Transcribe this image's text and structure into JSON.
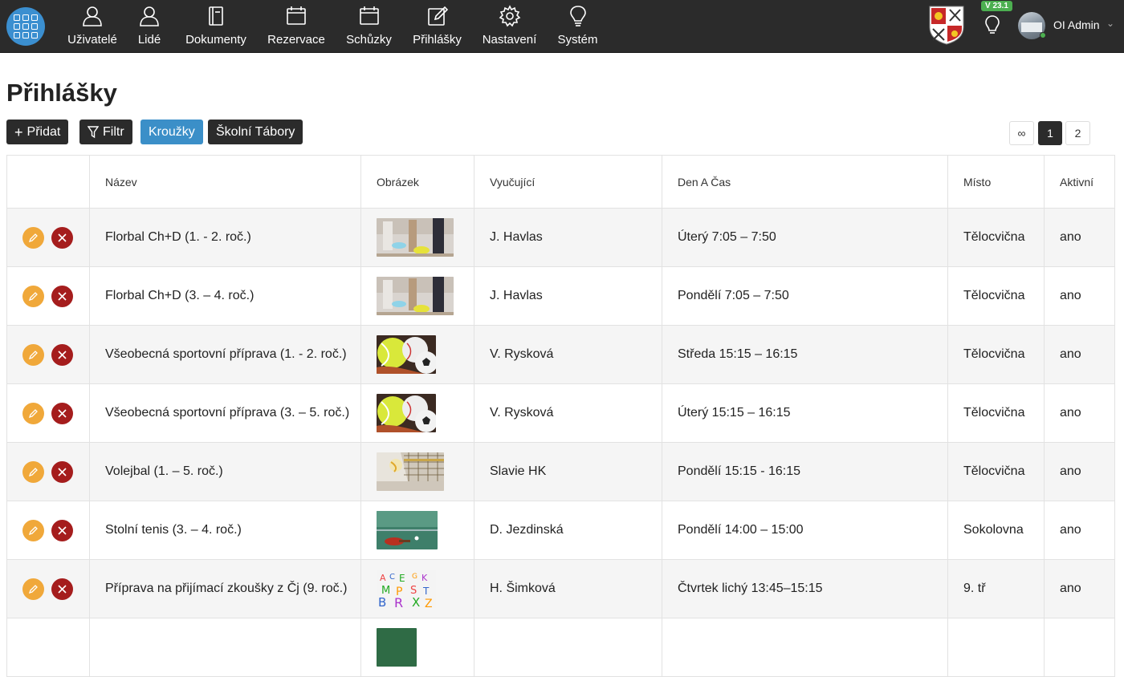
{
  "nav": {
    "items": [
      {
        "label": "Uživatelé",
        "icon": "user-icon"
      },
      {
        "label": "Lidé",
        "icon": "people-icon"
      },
      {
        "label": "Dokumenty",
        "icon": "document-icon"
      },
      {
        "label": "Rezervace",
        "icon": "calendar-icon"
      },
      {
        "label": "Schůzky",
        "icon": "calendar-icon"
      },
      {
        "label": "Přihlášky",
        "icon": "form-edit-icon"
      },
      {
        "label": "Nastavení",
        "icon": "gear-icon"
      },
      {
        "label": "Systém",
        "icon": "lightbulb-icon"
      }
    ],
    "version": "V 23.1",
    "user_name": "OI Admin"
  },
  "page": {
    "title": "Přihlášky",
    "buttons": {
      "add": "Přidat",
      "filter": "Filtr",
      "clubs": "Kroužky",
      "camps": "Školní Tábory"
    },
    "pagination": [
      "∞",
      "1",
      "2"
    ],
    "active_page": "1"
  },
  "table": {
    "headers": [
      "",
      "Název",
      "Obrázek",
      "Vyučující",
      "Den A Čas",
      "Místo",
      "Aktivní"
    ],
    "rows": [
      {
        "name": "Florbal Ch+D (1. - 2. roč.)",
        "image": "floorball",
        "teacher": "J. Havlas",
        "time": "Úterý 7:05 – 7:50",
        "place": "Tělocvična",
        "active": "ano"
      },
      {
        "name": "Florbal Ch+D (3. – 4. roč.)",
        "image": "floorball",
        "teacher": "J. Havlas",
        "time": "Pondělí 7:05 – 7:50",
        "place": "Tělocvična",
        "active": "ano"
      },
      {
        "name": "Všeobecná sportovní příprava (1. - 2. roč.)",
        "image": "balls",
        "teacher": "V. Rysková",
        "time": "Středa 15:15 – 16:15",
        "place": "Tělocvična",
        "active": "ano"
      },
      {
        "name": "Všeobecná sportovní příprava (3. – 5. roč.)",
        "image": "balls",
        "teacher": "V. Rysková",
        "time": "Úterý 15:15 – 16:15",
        "place": "Tělocvična",
        "active": "ano"
      },
      {
        "name": "Volejbal (1. – 5. roč.)",
        "image": "volleyball",
        "teacher": "Slavie HK",
        "time": "Pondělí 15:15 - 16:15",
        "place": "Tělocvična",
        "active": "ano"
      },
      {
        "name": "Stolní tenis (3. – 4. roč.)",
        "image": "tabletennis",
        "teacher": "D. Jezdinská",
        "time": "Pondělí 14:00 – 15:00",
        "place": "Sokolovna",
        "active": "ano"
      },
      {
        "name": "Příprava na přijímací zkoušky z Čj (9. roč.)",
        "image": "letters",
        "teacher": "H. Šimková",
        "time": "Čtvrtek lichý 13:45–15:15",
        "place": "9. tř",
        "active": "ano"
      },
      {
        "name": "",
        "image": "green",
        "teacher": "",
        "time": "",
        "place": "",
        "active": ""
      }
    ]
  },
  "colors": {
    "topbar": "#2b2b2b",
    "accent_blue": "#3b8fc8",
    "edit": "#f0a83a",
    "delete": "#a51d1d",
    "version_badge": "#4caf50"
  }
}
